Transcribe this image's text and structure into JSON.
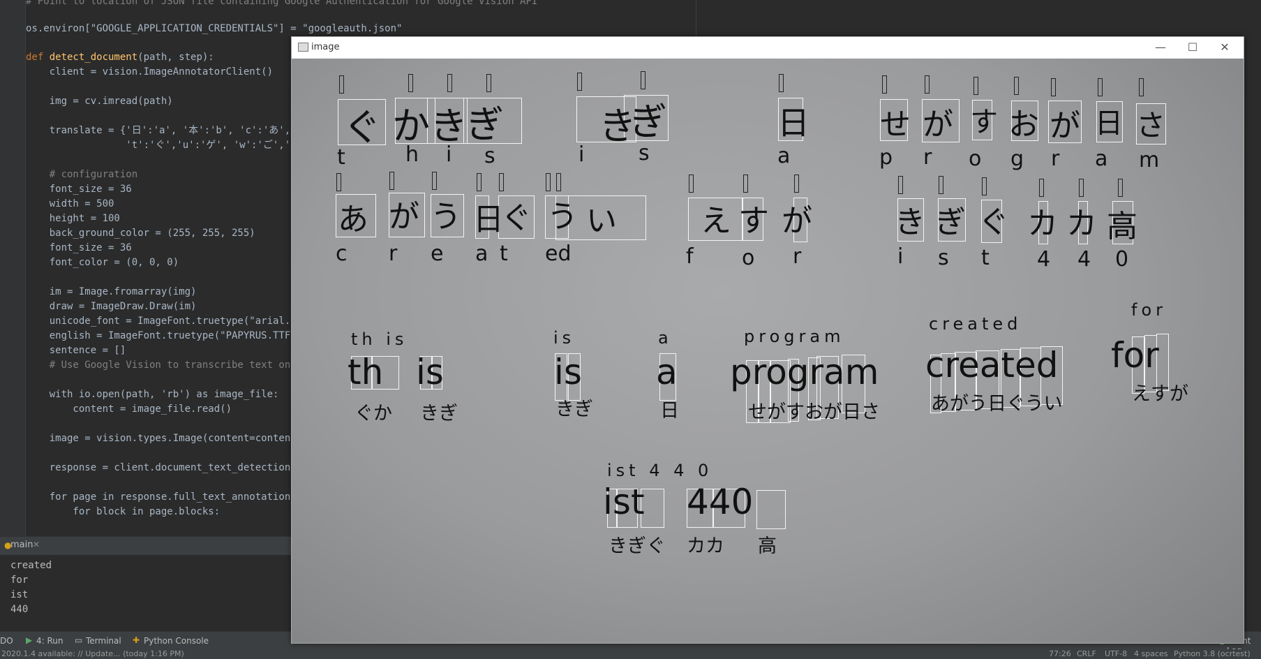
{
  "editor": {
    "lines": [
      "# Point to location of JSON file containing Google Authentication for Google Vision API",
      "os.environ[\"GOOGLE_APPLICATION_CREDENTIALS\"] = \"googleauth.json\"",
      "def detect_document(path, step):",
      "    client = vision.ImageAnnotatorClient()",
      "    img = cv.imread(path)",
      "    translate = {'日':'a', '本':'b', 'c':'あ','d'",
      "                 't':'ぐ','u':'ゲ', 'w':'ご','x':",
      "    # configuration",
      "    font_size = 36",
      "    width = 500",
      "    height = 100",
      "    back_ground_color = (255, 255, 255)",
      "    font_size = 36",
      "    font_color = (0, 0, 0)",
      "    im = Image.fromarray(img)",
      "    draw = ImageDraw.Draw(im)",
      "    unicode_font = ImageFont.truetype(\"arial.tt",
      "    english = ImageFont.truetype(\"PAPYRUS.TTF\",",
      "    sentence = []",
      "    # Use Google Vision to transcribe text on pa",
      "    with io.open(path, 'rb') as image_file:",
      "        content = image_file.read()",
      "    image = vision.types.Image(content=content)",
      "    response = client.document_text_detection(i",
      "    for page in response.full_text_annotation.pa",
      "        for block in page.blocks:"
    ]
  },
  "run": {
    "tab_label": "main",
    "output": [
      "created",
      "for",
      "ist",
      "440"
    ]
  },
  "toolbar": {
    "todo": "DO",
    "run": "4: Run",
    "terminal": "Terminal",
    "python_console": "Python Console",
    "event_log": "Event Log"
  },
  "statusbar": {
    "update": "2020.1.4 available: // Update... (today 1:16 PM)",
    "position": "77:26",
    "line_sep": "CRLF",
    "encoding": "UTF-8",
    "indent": "4 spaces",
    "interpreter": "Python 3.8 (ocrtest)"
  },
  "image_window": {
    "title": "image",
    "controls": {
      "minimize": "—",
      "maximize": "☐",
      "close": "✕"
    },
    "handwriting_row1": [
      "ぐ",
      "か",
      "き",
      "ぎ",
      "き",
      "ぎ",
      "日",
      "せ",
      "が",
      "す",
      "お",
      "が",
      "日",
      "さ"
    ],
    "latin_row1": [
      "t",
      "h",
      "i",
      "s",
      "i",
      "s",
      "a",
      "p",
      "r",
      "o",
      "g",
      "r",
      "a",
      "m"
    ],
    "handwriting_row2": [
      "あ",
      "が",
      "う",
      "日",
      "ぐ",
      "う",
      "い",
      "え",
      "す",
      "が",
      "き",
      "ぎ",
      "ぐ",
      "カ",
      "カ",
      "高"
    ],
    "latin_row2": [
      "c",
      "r",
      "e",
      "a",
      "t",
      "ed",
      "f",
      "o",
      "r",
      "i",
      "s",
      "t",
      "4",
      "4",
      "0"
    ],
    "ocr_latin": [
      "th is",
      "is",
      "a",
      "program",
      "created",
      "for",
      "ist 4 4 0"
    ],
    "ocr_words": [
      "th",
      "is",
      "is",
      "a",
      "program",
      "created",
      "for",
      "ist",
      "440"
    ],
    "ocr_japanese": [
      "ぐか",
      "きぎ",
      "きぎ",
      "日",
      "せがすおが日さ",
      "あがう日ぐうい",
      "えすが",
      "きぎぐ",
      "カカ",
      "高"
    ]
  }
}
